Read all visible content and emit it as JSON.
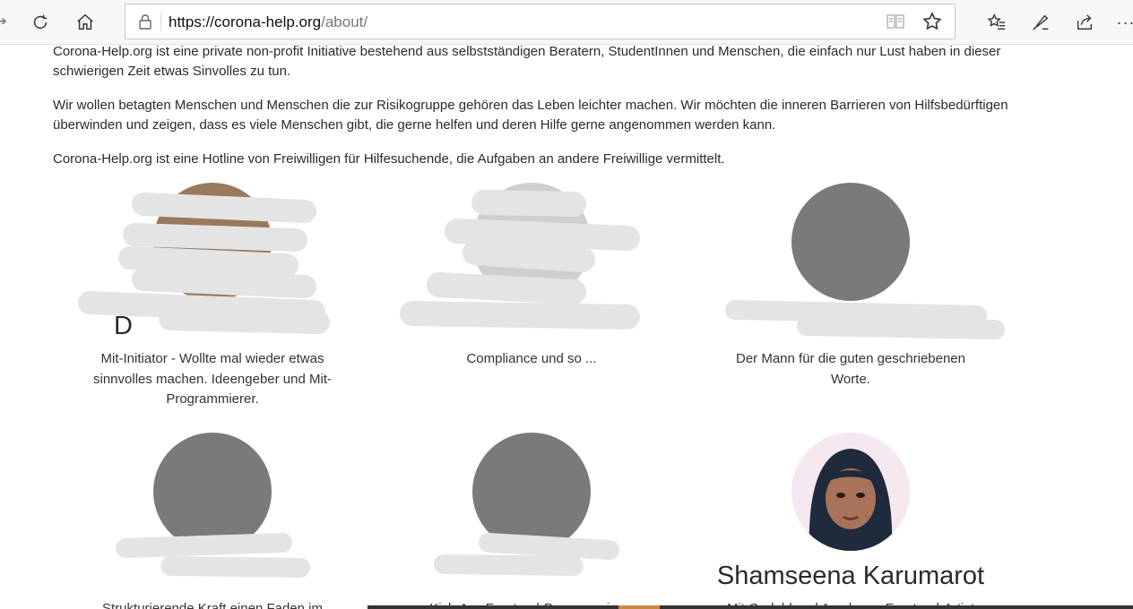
{
  "browser": {
    "url_host": "https://corona-help.org",
    "url_path": "/about/",
    "icons": {
      "back": "back-arrow-icon",
      "refresh": "refresh-icon",
      "home": "home-icon",
      "lock": "lock-icon",
      "reader": "reading-view-icon",
      "favorite": "star-icon",
      "favorites_hub": "favorites-list-icon",
      "notes": "pen-icon",
      "share": "share-icon",
      "more": "more-icon"
    },
    "more_label": "···"
  },
  "intro": {
    "p1": "Corona-Help.org ist eine private non-profit Initiative bestehend aus selbstständigen Beratern, StudentInnen und Menschen, die einfach nur Lust haben in dieser schwierigen Zeit etwas Sinvolles zu tun.",
    "p2": "Wir wollen betagten Menschen und Menschen die zur Risikogruppe gehören das Leben leichter machen. Wir möchten die inneren Barrieren von Hilfsbedürftigen überwinden und zeigen, dass es viele Menschen gibt, die gerne helfen und deren Hilfe gerne angenommen werden kann.",
    "p3": "Corona-Help.org ist eine Hotline von Freiwilligen für Hilfesuchende, die Aufgaben an andere Freiwillige vermittelt."
  },
  "team": [
    {
      "name": "D",
      "role": "Mit-Initiator - Wollte mal wieder etwas sinnvolles machen. Ideengeber und Mit-Programmierer."
    },
    {
      "name": "",
      "role": "Compliance und so ..."
    },
    {
      "name": "",
      "role": "Der Mann für die guten geschriebenen Worte."
    },
    {
      "name": "",
      "role": "Strukturierende Kraft einen Faden im"
    },
    {
      "name": "",
      "role": "Kick-Ass Frontend-Programmierer"
    },
    {
      "name": "Shamseena Karumarot",
      "role": "Mit Geduld und Ausdauer. Frontend-Artist"
    }
  ],
  "colors": {
    "placeholder_avatar": "#7a7a7a",
    "redaction": "#e4e4e4"
  }
}
